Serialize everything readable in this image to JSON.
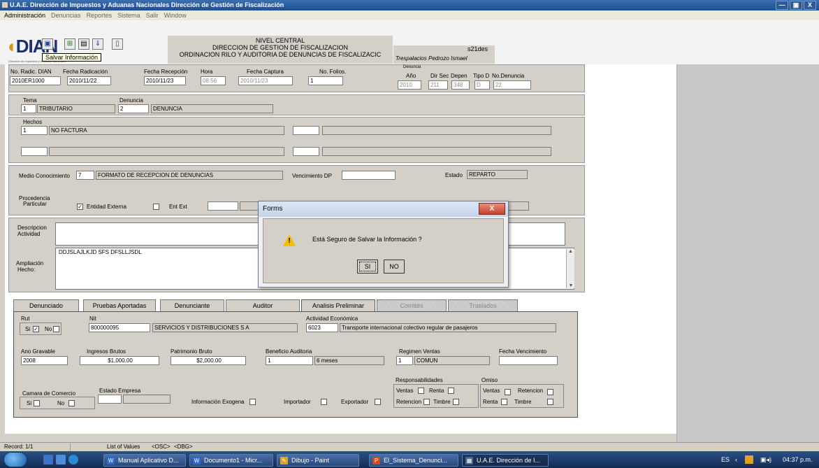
{
  "window": {
    "title": "U.A.E. Dirección de Impuestos y Aduanas Nacionales  Dirección de Gestión de Fiscalización",
    "min": "—",
    "max": "▣",
    "close": "X"
  },
  "menu": [
    "Administración",
    "Denuncias",
    "Reportes",
    "Sistema",
    "Salir",
    "Window"
  ],
  "toolbar": {
    "logo_main": "DIAN",
    "logo_sub": "Dirección de Impuestos y Aduanas Nacionales",
    "tooltip": "Salvar Información",
    "header_line1": "NIVEL CENTRAL",
    "header_line2": "DIRECCION DE GESTION DE FISCALIZACION",
    "header_line3": "ORDINACION RILO Y AUDITORIA DE DENUNCIAS DE FISCALIZACIC",
    "user_code": "s21des",
    "user_name": "Trespalacios Pedrozo Ismael"
  },
  "radic": {
    "lbl_no": "No. Radic. DIAN",
    "no": "2010ER1000",
    "lbl_fecha": "Fecha Radicación",
    "fecha": "2010/11/22",
    "lbl_recep": "Fecha Recepción",
    "recep": "2010/11/23",
    "lbl_hora": "Hora",
    "hora": "08:56",
    "lbl_captura": "Fecha Captura",
    "captura": "2010/11/23",
    "lbl_folios": "No. Folios.",
    "folios": "1",
    "lbl_den": "Denuncia",
    "lbl_ano": "Año",
    "ano": "2010",
    "lbl_dirsec": "Dir Sec",
    "dirsec": "211",
    "lbl_depen": "Depen",
    "depen": "348",
    "lbl_tipo": "Tipo D",
    "tipo": "D",
    "lbl_nodenuncia": "No.Denuncia",
    "nodenuncia": "22"
  },
  "tema": {
    "lbl_tema": "Tema",
    "tema_code": "1",
    "tema_desc": "TRIBUTARIO",
    "lbl_denuncia": "Denuncia",
    "den_code": "2",
    "den_desc": "DENUNCIA"
  },
  "hechos": {
    "lbl": "Hechos",
    "code": "1",
    "desc": "NO FACTURA"
  },
  "medio": {
    "lbl": "Medio Conocimiento",
    "code": "7",
    "desc": "FORMATO DE RECEPCION DE DENUNCIAS",
    "lbl_venc": "Vencimiento DP",
    "venc": "",
    "lbl_estado": "Estado",
    "estado": "REPARTO"
  },
  "procedencia": {
    "lbl1": "Procedencia",
    "lbl2": "Particular",
    "particular_mark": "✓",
    "lbl_entidad": "Entidad Externa",
    "lbl_entext": "Ent Ext"
  },
  "descripcion": {
    "lbl1": "Descripcion",
    "lbl2": "Actividad",
    "text": ""
  },
  "ampliacion": {
    "lbl1": "Ampliación",
    "lbl2": "Hecho:",
    "text": "DDJSLAJLKJD SFS DFSLLJSDL"
  },
  "tabs": [
    {
      "label": "Denunciado"
    },
    {
      "label": "Pruebas Aportadas"
    },
    {
      "label": "Denunciante"
    },
    {
      "label": "Auditor"
    },
    {
      "label": "Analisis Preliminar"
    },
    {
      "label": "Comites"
    },
    {
      "label": "Traslados"
    }
  ],
  "analisis": {
    "lbl_rut": "Rut",
    "lbl_si": "Si",
    "si_mark": "✓",
    "lbl_no": "No",
    "lbl_nit": "Nit",
    "nit": "800000095",
    "nit_name": "SERVICIOS Y DISTRIBUCIONES S A",
    "lbl_act": "Actividad Económica",
    "act_code": "6023",
    "act_desc": "Transporte internacional colectivo regular de pasajeros",
    "lbl_ano": "Ano Gravable",
    "ano": "2008",
    "lbl_ingresos": "Ingresos Brutos",
    "ingresos": "$1,000.00",
    "lbl_patrimonio": "Patrimonio Bruto",
    "patrimonio": "$2,000.00",
    "lbl_beneficio": "Beneficio Auditoria",
    "beneficio_code": "1",
    "beneficio_desc": "6 meses",
    "lbl_regimen": "Regimen Ventas",
    "regimen_code": "1",
    "regimen_desc": "COMUN",
    "lbl_fechav": "Fecha Vencimiento",
    "fechav": "",
    "lbl_camara": "Camara de Comercio",
    "lbl_estado_emp": "Estado Empresa",
    "lbl_exogena": "Información Exogena",
    "lbl_importador": "Importador",
    "lbl_exportador": "Exportador",
    "lbl_resp": "Responsabilidades",
    "lbl_omiso": "Omiso",
    "lbl_ventas": "Ventas",
    "lbl_renta": "Renta",
    "lbl_retencion": "Retencion",
    "lbl_timbre": "Timbre"
  },
  "dialog": {
    "title": "Forms",
    "message": "Está Seguro de Salvar la Información  ?",
    "yes": "SI",
    "no": "NO",
    "close": "X"
  },
  "status": {
    "record": "Record: 1/1",
    "lov": "List of Values",
    "osc": "<OSC>",
    "dbg": "<DBG>"
  },
  "taskbar": {
    "tasks": [
      "Manual Aplicativo D...",
      "Documento1 - Micr...",
      "Dibujo - Paint",
      "El_Sistema_Denunci...",
      "U.A.E. Dirección de I..."
    ],
    "lang": "ES",
    "time": "04:37 p.m."
  }
}
